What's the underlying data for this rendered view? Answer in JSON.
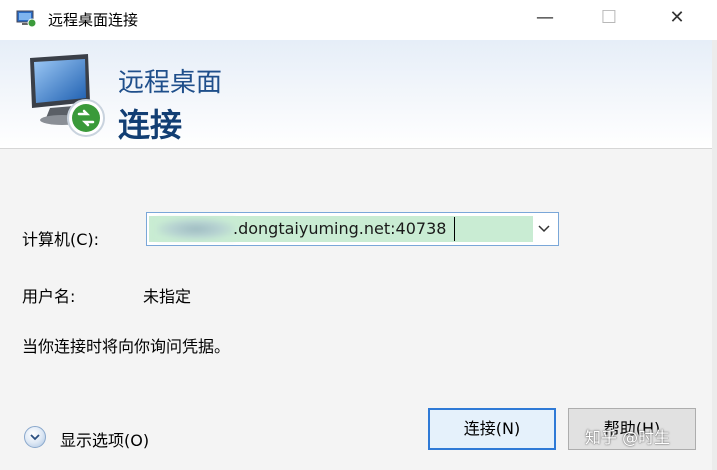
{
  "window": {
    "title": "远程桌面连接",
    "controls": {
      "minimize": "—",
      "maximize": "☐",
      "close": "✕"
    }
  },
  "banner": {
    "line1": "远程桌面",
    "line2": "连接"
  },
  "form": {
    "computer_label": "计算机(C):",
    "computer_value": ".dongtaiyuming.net:40738",
    "username_label": "用户名:",
    "username_value": "未指定",
    "hint": "当你连接时将向你询问凭据。"
  },
  "footer": {
    "show_options": "显示选项(O)",
    "connect_button": "连接(N)",
    "help_button": "帮助(H)"
  },
  "watermark": "知乎 @时生",
  "colors": {
    "accent": "#2f7ad6",
    "banner_title": "#1f4f8b",
    "input_highlight": "#c9ecd3"
  },
  "icons": {
    "app": "remote-desktop-icon",
    "banner": "monitor-remote-icon",
    "dropdown": "chevron-down-icon",
    "options": "expand-circle-icon"
  }
}
